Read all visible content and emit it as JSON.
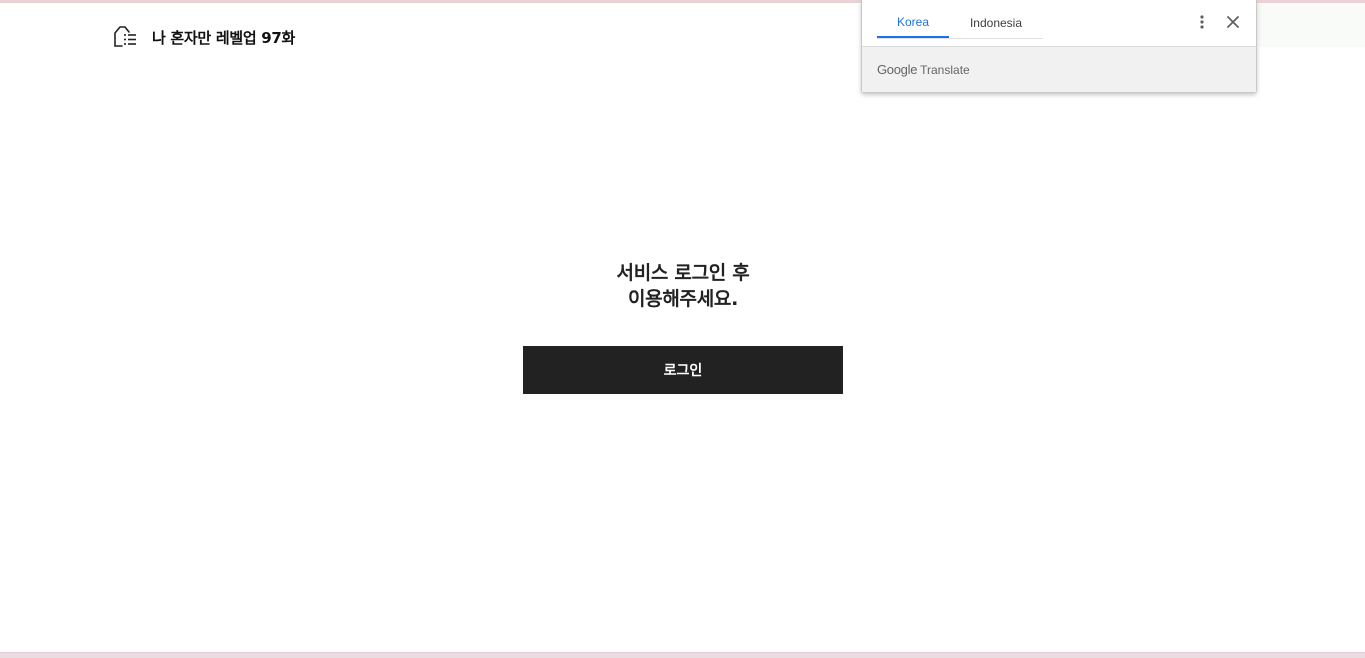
{
  "header": {
    "menu_icon": "episode-list-icon",
    "title": "나 혼자만 레벨업 97화"
  },
  "main": {
    "notice_line1": "서비스 로그인 후",
    "notice_line2": "이용해주세요.",
    "login_label": "로그인"
  },
  "translate_popup": {
    "tabs": [
      {
        "label": "Korea",
        "active": true
      },
      {
        "label": "Indonesia",
        "active": false
      }
    ],
    "more_icon": "more-vert-icon",
    "close_icon": "close-icon",
    "brand": "Google",
    "product": "Translate",
    "accent_color": "#1a73e8"
  },
  "colors": {
    "button_bg": "#222222",
    "text_primary": "#222222",
    "border_top": "#ead2d7"
  }
}
